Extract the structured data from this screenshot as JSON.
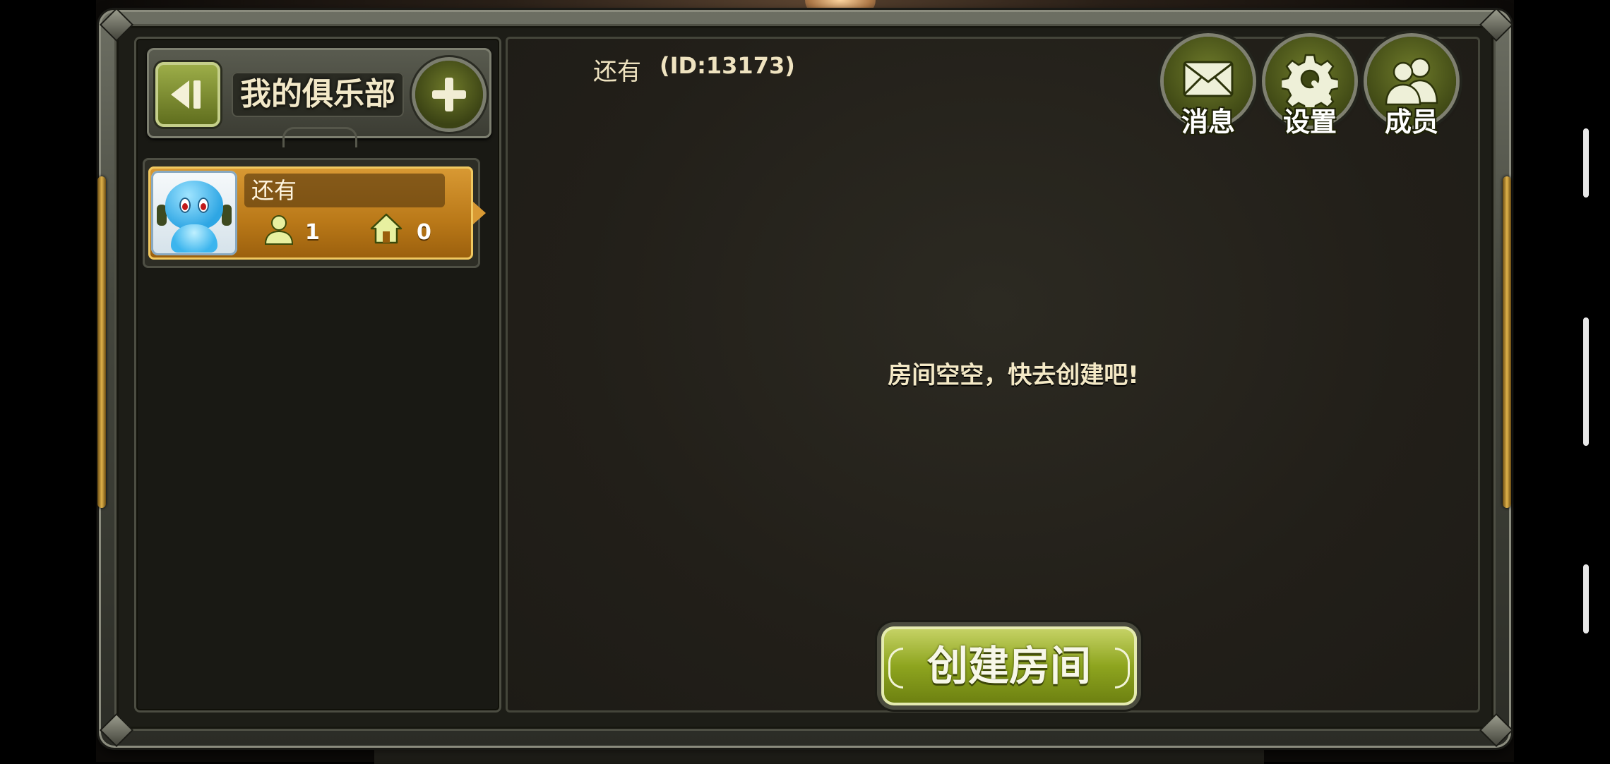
{
  "header": {
    "title": "我的俱乐部"
  },
  "club_list": [
    {
      "name": "还有",
      "member_count": "1",
      "room_count": "0"
    }
  ],
  "selected_club": {
    "name": "还有",
    "id_label": "(ID:13173)"
  },
  "top_actions": {
    "messages_label": "消息",
    "settings_label": "设置",
    "members_label": "成员"
  },
  "empty_state": {
    "message": "房间空空，快去创建吧!"
  },
  "create_room_label": "创建房间",
  "icons": {
    "back": "back-arrow-icon",
    "add": "plus-icon",
    "member": "person-icon",
    "room": "house-icon",
    "messages": "envelope-icon",
    "settings": "gear-icon",
    "members": "people-icon"
  },
  "colors": {
    "accent_green": "#8ea51f",
    "card_gold": "#d99a34",
    "text_cream": "#f4e9c6"
  }
}
